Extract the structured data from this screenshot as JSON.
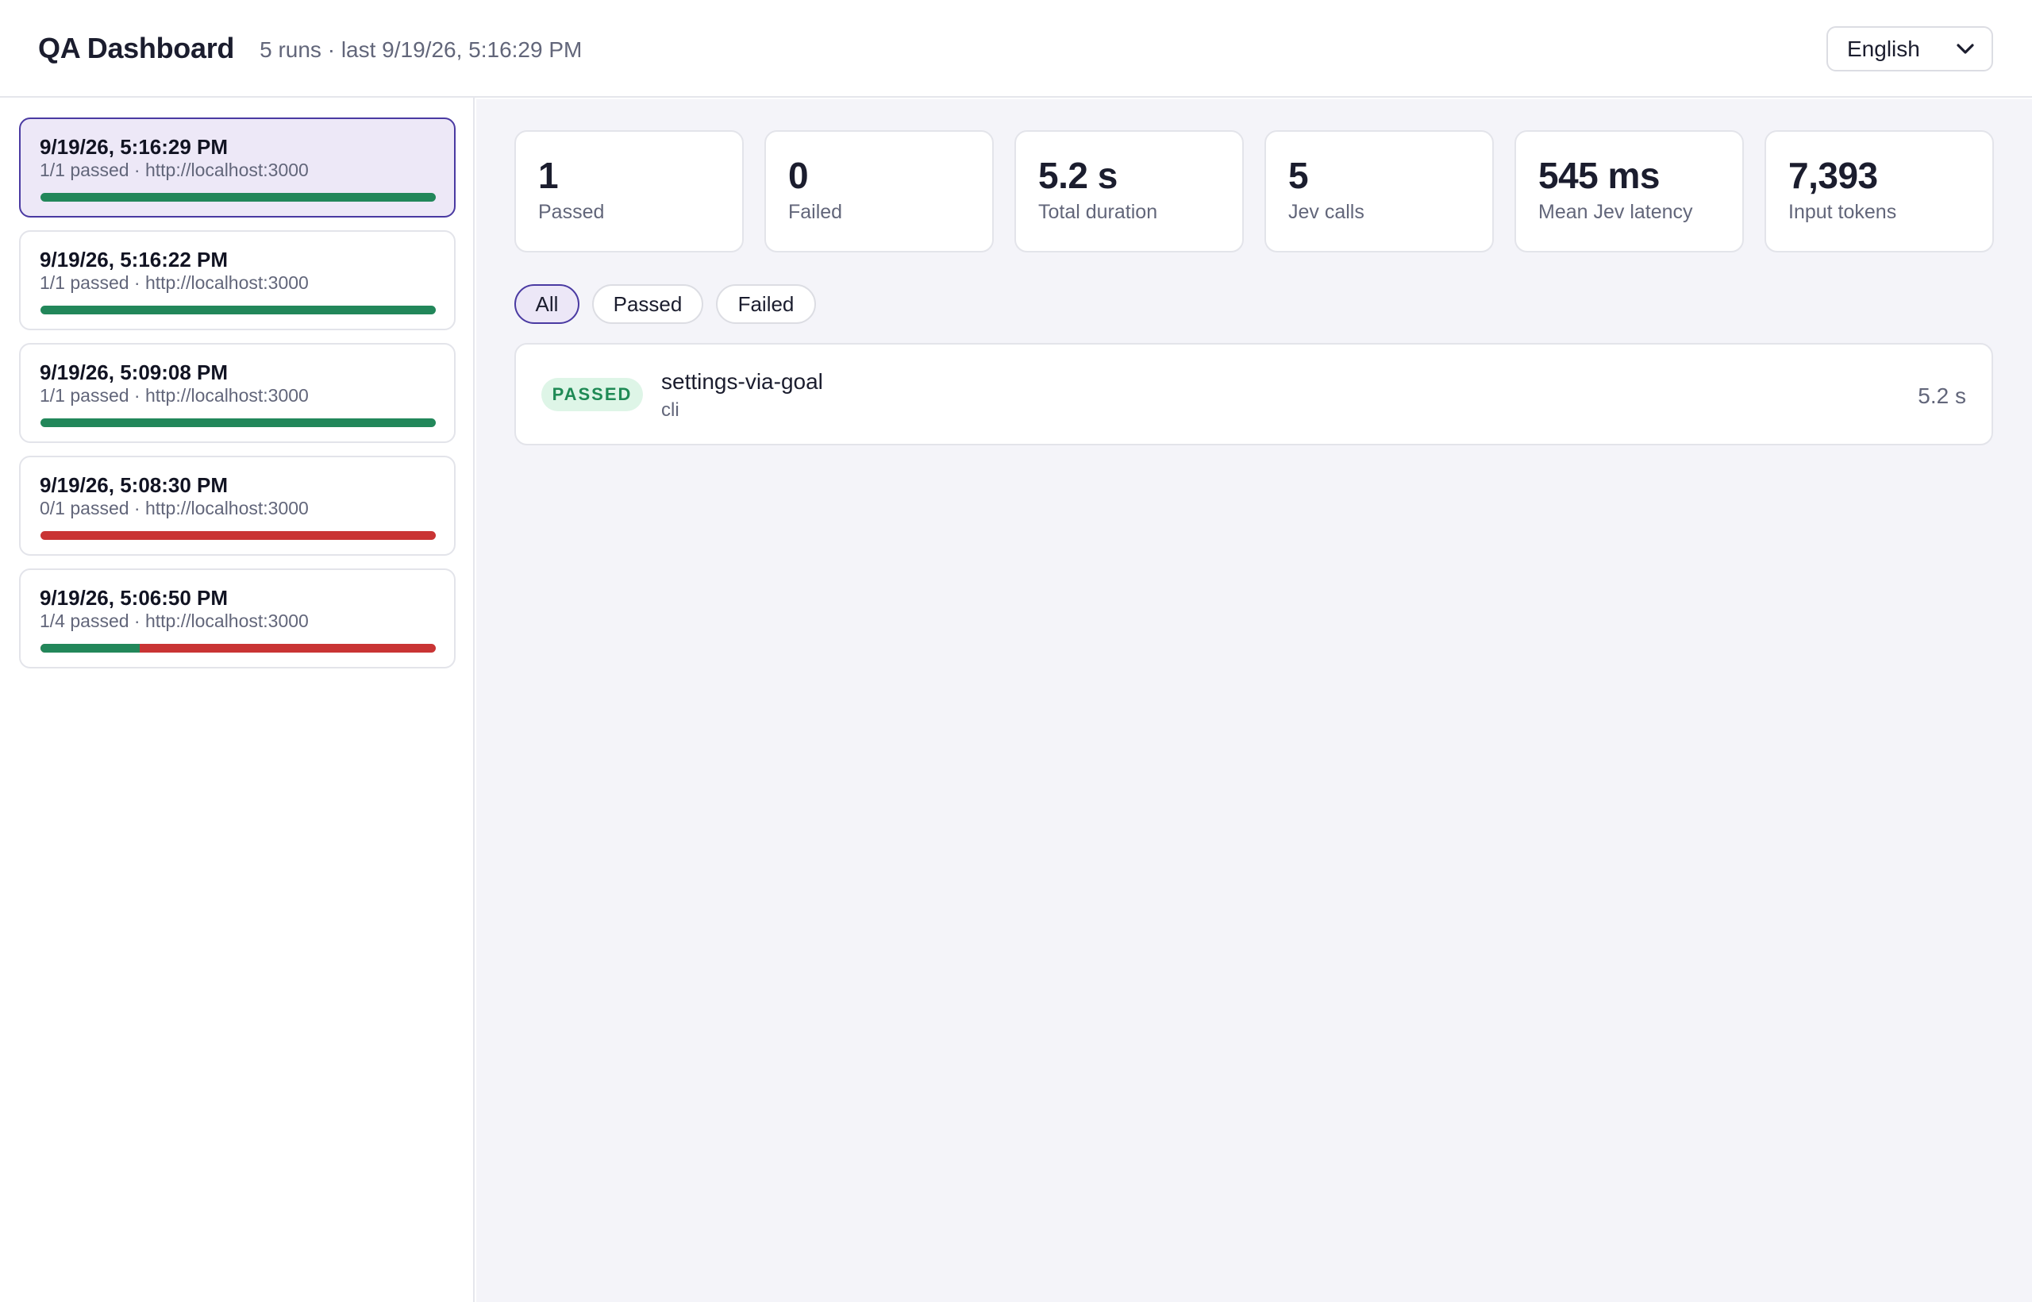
{
  "header": {
    "title": "QA Dashboard",
    "meta": "5 runs · last 9/19/26, 5:16:29 PM",
    "language": {
      "selected": "English",
      "icon": "chevron-down-icon"
    }
  },
  "runs": [
    {
      "title": "9/19/26, 5:16:29 PM",
      "summary": "1/1 passed · http://localhost:3000",
      "passed": 1,
      "total": 1,
      "selected": true
    },
    {
      "title": "9/19/26, 5:16:22 PM",
      "summary": "1/1 passed · http://localhost:3000",
      "passed": 1,
      "total": 1,
      "selected": false
    },
    {
      "title": "9/19/26, 5:09:08 PM",
      "summary": "1/1 passed · http://localhost:3000",
      "passed": 1,
      "total": 1,
      "selected": false
    },
    {
      "title": "9/19/26, 5:08:30 PM",
      "summary": "0/1 passed · http://localhost:3000",
      "passed": 0,
      "total": 1,
      "selected": false
    },
    {
      "title": "9/19/26, 5:06:50 PM",
      "summary": "1/4 passed · http://localhost:3000",
      "passed": 1,
      "total": 4,
      "selected": false
    }
  ],
  "stats": [
    {
      "value": "1",
      "label": "Passed"
    },
    {
      "value": "0",
      "label": "Failed"
    },
    {
      "value": "5.2 s",
      "label": "Total duration"
    },
    {
      "value": "5",
      "label": "Jev calls"
    },
    {
      "value": "545 ms",
      "label": "Mean Jev latency"
    },
    {
      "value": "7,393",
      "label": "Input tokens"
    }
  ],
  "filters": [
    {
      "label": "All",
      "active": true
    },
    {
      "label": "Passed",
      "active": false
    },
    {
      "label": "Failed",
      "active": false
    }
  ],
  "tests": [
    {
      "status": "PASSED",
      "name": "settings-via-goal",
      "runner": "cli",
      "duration": "5.2 s"
    }
  ],
  "colors": {
    "pass": "#22875a",
    "fail": "#c93434",
    "accent": "#4a3aa2",
    "selected_bg": "#ede8f7"
  }
}
